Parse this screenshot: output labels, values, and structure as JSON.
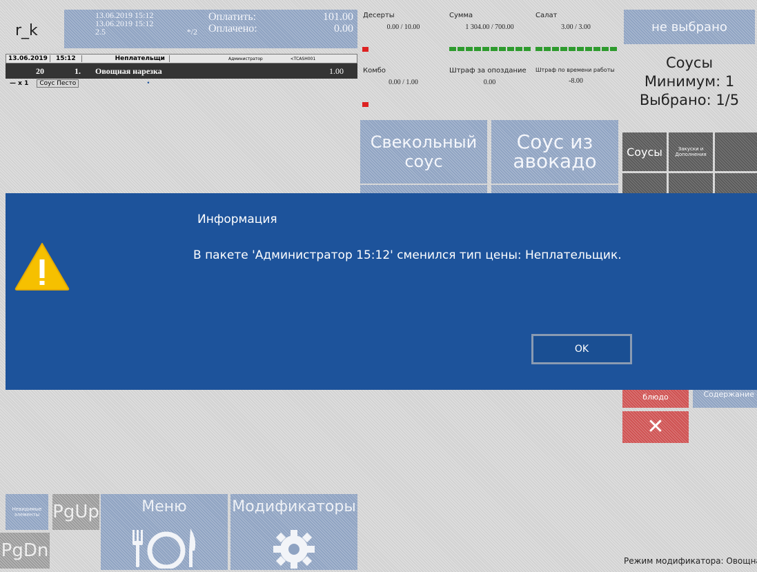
{
  "header": {
    "terminal": "r_k",
    "date1": "13.06.2019 15:12",
    "date2": "13.06.2019 15:12",
    "guests": "2.5",
    "table": "*/2",
    "pay_label": "Оплатить:",
    "pay_value": "101.00",
    "paid_label": "Оплачено:",
    "paid_value": "0.00"
  },
  "order": {
    "head_date": "13.06.2019",
    "head_time": "15:12",
    "head_price_type": "Неплательщи",
    "head_user": "Администратор",
    "head_cash": "<TCASH001",
    "row_table": "20",
    "row_num": "1.",
    "row_name": "Овощная нарезка",
    "row_qty": "1.00",
    "mod_qty": "x 1",
    "mod_name": "Соус Песто",
    "mod_dot": "•"
  },
  "stats": [
    {
      "label": "Десерты",
      "value": "0.00 / 10.00"
    },
    {
      "label": "Сумма",
      "value": "1 304.00 / 700.00"
    },
    {
      "label": "Салат",
      "value": "3.00 / 3.00"
    },
    {
      "label": "Комбо",
      "value": "0.00 / 1.00"
    },
    {
      "label": "Штраф за опоздание",
      "value": "0.00"
    },
    {
      "label": "Штраф по времени работы",
      "value": "-8.00"
    }
  ],
  "right_panel": {
    "none_selected": "не выбрано",
    "group_name": "Соусы",
    "minimum": "Минимум: 1",
    "selected": "Выбрано: 1/5"
  },
  "modifier_buttons": [
    {
      "label": "Свекольный соус"
    },
    {
      "label": "Соус из авокадо"
    }
  ],
  "categories": [
    {
      "label": "Соусы"
    },
    {
      "label": "Закуски и Дополнения"
    }
  ],
  "side_buttons": {
    "dish": "блюдо",
    "content": "Содержание",
    "delete": "✕"
  },
  "dialog": {
    "title": "Информация",
    "message": "В пакете 'Администратор  15:12' сменился тип цены: Неплательщик.",
    "ok": "OK"
  },
  "bottom": {
    "invisible_items": "Невидимые элементы",
    "pgup": "PgUp",
    "pgdn": "PgDn",
    "menu": "Меню",
    "modifiers": "Модификаторы",
    "status": "Режим модификатора: Овощна"
  },
  "colors": {
    "dialog_bg": "#1d539b",
    "button_blue": "#8fa3c2",
    "delete_red": "#cf5252",
    "progress_green": "#2e9b2e"
  }
}
